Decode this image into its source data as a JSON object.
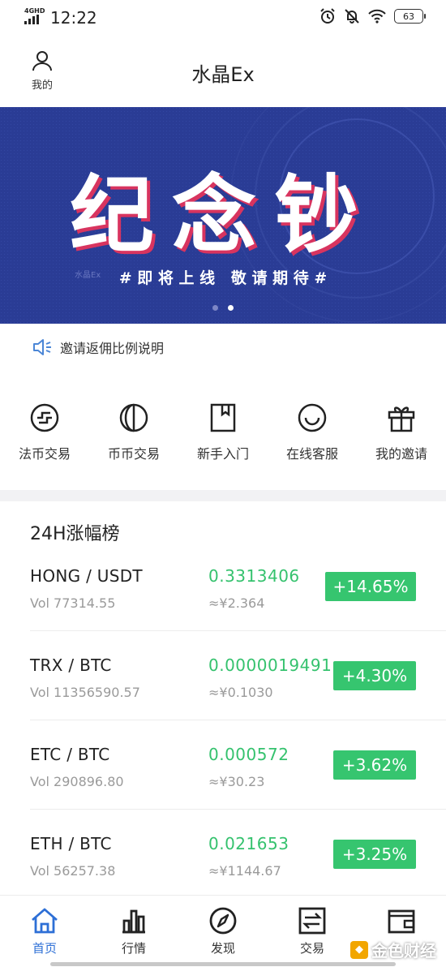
{
  "status_bar": {
    "network": "4GHD",
    "time": "12:22",
    "battery": "63"
  },
  "header": {
    "me_label": "我的",
    "title": "水晶Ex"
  },
  "banner": {
    "headline": "纪念钞",
    "subline": "# 即 将 上 线   敬 请 期 待 #",
    "small_mark": "水晶Ex"
  },
  "notice": {
    "text": "邀请返佣比例说明"
  },
  "quick_menu": [
    {
      "label": "法币交易",
      "icon": "fiat-exchange-icon"
    },
    {
      "label": "币币交易",
      "icon": "coin-exchange-icon"
    },
    {
      "label": "新手入门",
      "icon": "bookmark-icon"
    },
    {
      "label": "在线客服",
      "icon": "smile-icon"
    },
    {
      "label": "我的邀请",
      "icon": "gift-icon"
    }
  ],
  "ranking": {
    "title": "24H涨幅榜",
    "rows": [
      {
        "pair": "HONG / USDT",
        "vol": "Vol  77314.55",
        "price": "0.3313406",
        "cny": "≈¥2.364",
        "change": "+14.65%"
      },
      {
        "pair": "TRX / BTC",
        "vol": "Vol  11356590.57",
        "price": "0.0000019491",
        "cny": "≈¥0.1030",
        "change": "+4.30%"
      },
      {
        "pair": "ETC / BTC",
        "vol": "Vol  290896.80",
        "price": "0.000572",
        "cny": "≈¥30.23",
        "change": "+3.62%"
      },
      {
        "pair": "ETH / BTC",
        "vol": "Vol  56257.38",
        "price": "0.021653",
        "cny": "≈¥1144.67",
        "change": "+3.25%"
      }
    ]
  },
  "tab_bar": [
    {
      "label": "首页",
      "icon": "home-icon",
      "active": true
    },
    {
      "label": "行情",
      "icon": "bar-chart-icon",
      "active": false
    },
    {
      "label": "发现",
      "icon": "compass-icon",
      "active": false
    },
    {
      "label": "交易",
      "icon": "exchange-icon",
      "active": false
    },
    {
      "label": "",
      "icon": "wallet-icon",
      "active": false
    }
  ],
  "watermark": {
    "text": "金色财经"
  },
  "colors": {
    "accent_green": "#36c56f",
    "tab_active": "#2d6fd6",
    "banner_bg": "#2a3c95"
  }
}
